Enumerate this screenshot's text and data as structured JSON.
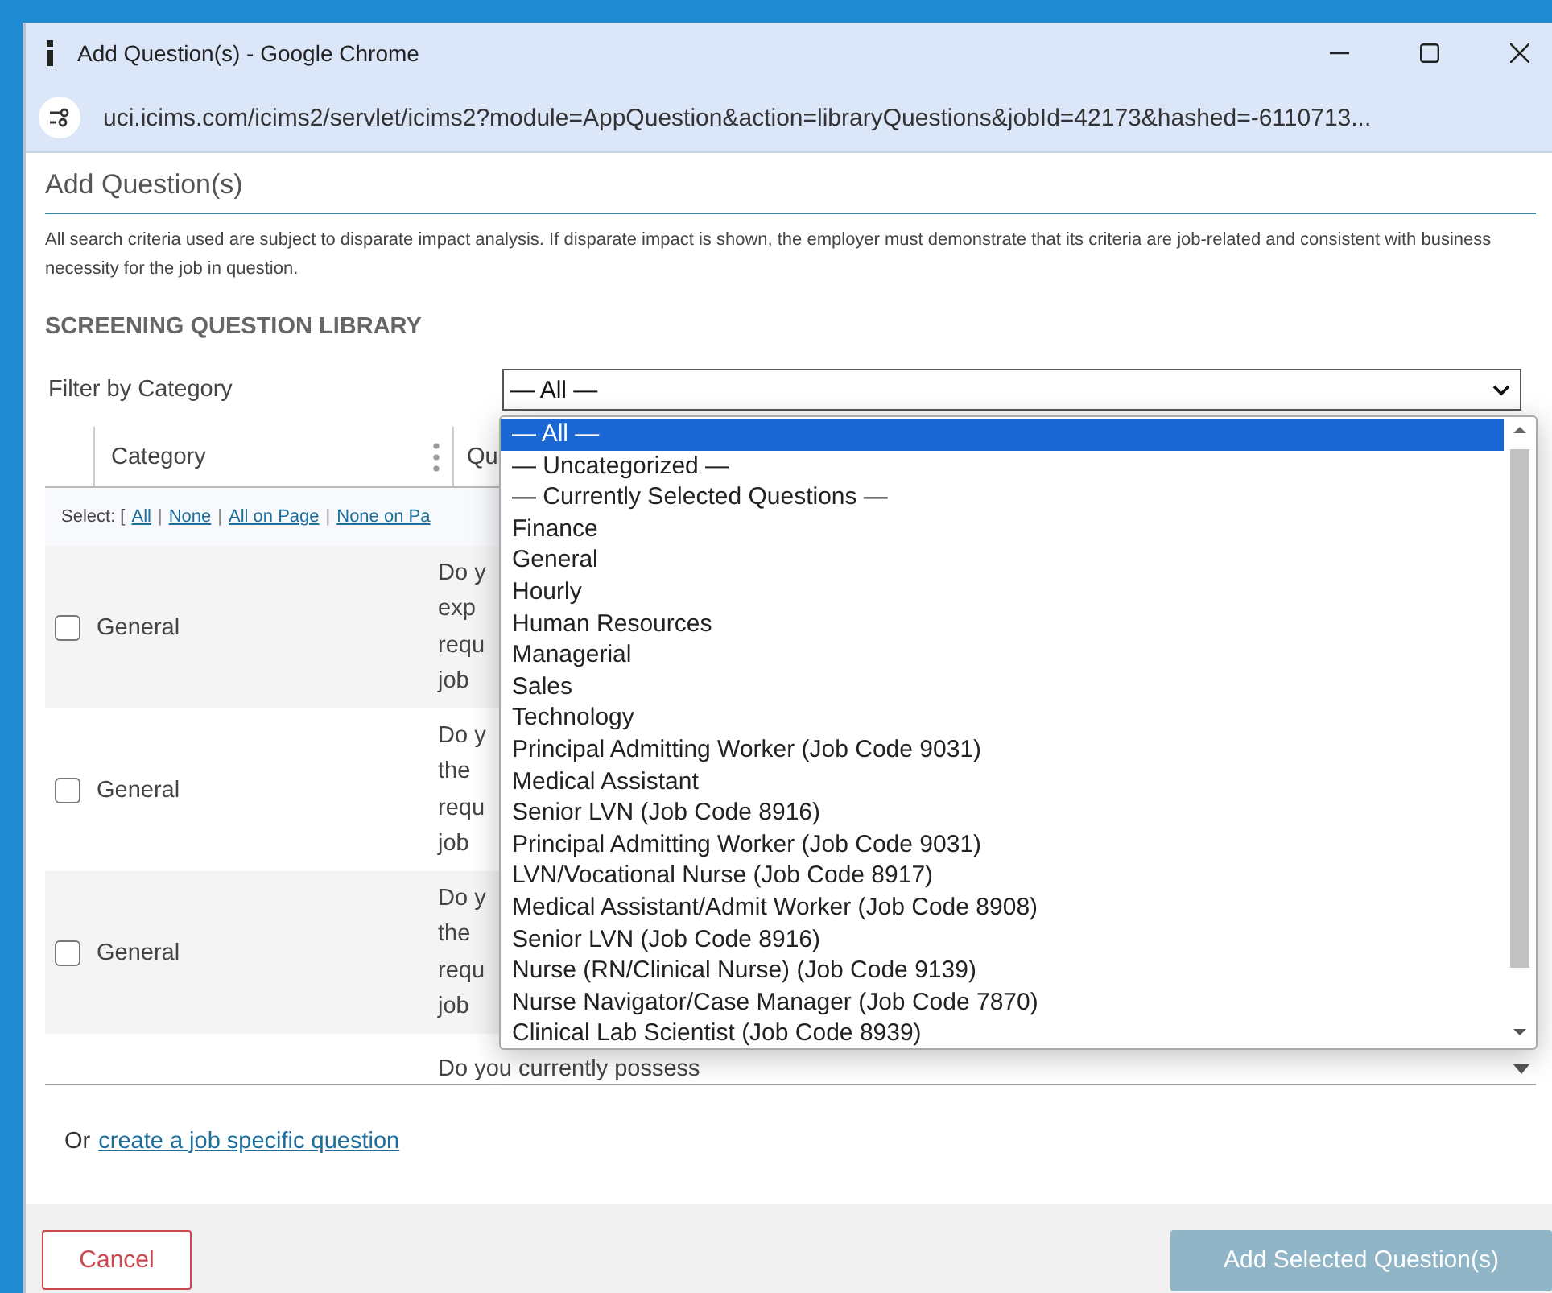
{
  "window": {
    "title": "Add Question(s) - Google Chrome"
  },
  "address_bar": {
    "url": "uci.icims.com/icims2/servlet/icims2?module=AppQuestion&action=libraryQuestions&jobId=42173&hashed=-6110713..."
  },
  "dialog": {
    "title": "Add Question(s)",
    "disclaimer": "All search criteria used are subject to disparate impact analysis. If disparate impact is shown, the employer must demonstrate that its criteria are job-related and consistent with business necessity for the job in question.",
    "section_title": "SCREENING QUESTION LIBRARY"
  },
  "filter": {
    "label": "Filter by Category",
    "value": "— All —",
    "options": [
      {
        "label": "— All —",
        "selected": true
      },
      {
        "label": "— Uncategorized —",
        "selected": false
      },
      {
        "label": "— Currently Selected Questions —",
        "selected": false
      },
      {
        "label": "Finance",
        "selected": false
      },
      {
        "label": "General",
        "selected": false
      },
      {
        "label": "Hourly",
        "selected": false
      },
      {
        "label": "Human Resources",
        "selected": false
      },
      {
        "label": "Managerial",
        "selected": false
      },
      {
        "label": "Sales",
        "selected": false
      },
      {
        "label": "Technology",
        "selected": false
      },
      {
        "label": "Principal Admitting Worker (Job Code 9031)",
        "selected": false
      },
      {
        "label": "Medical Assistant",
        "selected": false
      },
      {
        "label": "Senior LVN (Job Code 8916)",
        "selected": false
      },
      {
        "label": "Principal Admitting Worker (Job Code 9031)",
        "selected": false
      },
      {
        "label": "LVN/Vocational Nurse (Job Code 8917)",
        "selected": false
      },
      {
        "label": "Medical Assistant/Admit Worker (Job Code 8908)",
        "selected": false
      },
      {
        "label": "Senior LVN (Job Code 8916)",
        "selected": false
      },
      {
        "label": "Nurse (RN/Clinical Nurse) (Job Code 9139)",
        "selected": false
      },
      {
        "label": "Nurse Navigator/Case Manager (Job Code 7870)",
        "selected": false
      },
      {
        "label": "Clinical Lab Scientist (Job Code 8939)",
        "selected": false
      }
    ]
  },
  "table": {
    "columns": [
      "Category",
      "Qu"
    ],
    "select_separator": "|",
    "select_label": "Select: [",
    "select_links": [
      "All",
      "None",
      "All on Page",
      "None on Pa"
    ],
    "rows": [
      {
        "checked": false,
        "category": "General",
        "question": [
          "Do y",
          "exp",
          "requ",
          "job"
        ]
      },
      {
        "checked": false,
        "category": "General",
        "question": [
          "Do y",
          "the",
          "requ",
          "job"
        ]
      },
      {
        "checked": false,
        "category": "General",
        "question": [
          "Do y",
          "the",
          "requ",
          "job"
        ]
      }
    ],
    "partial_row": "Do you currently possess"
  },
  "create_prefix": "Or",
  "create_link": "create a job specific question",
  "buttons": {
    "cancel": "Cancel",
    "add": "Add Selected Question(s)"
  }
}
